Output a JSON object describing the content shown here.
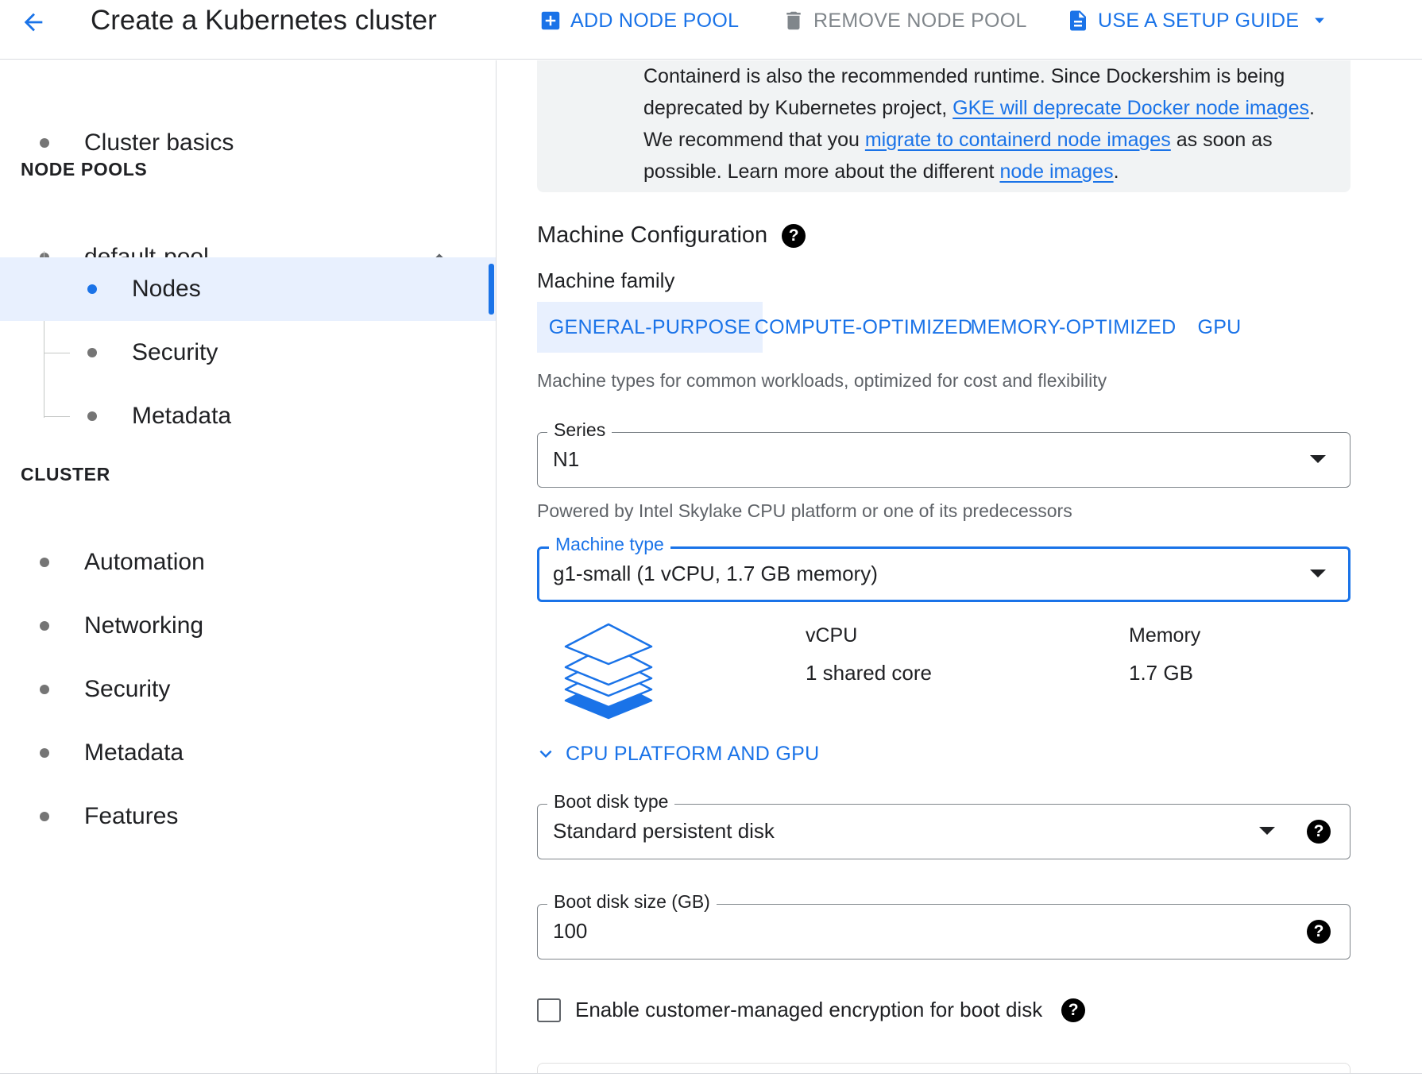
{
  "header": {
    "title": "Create a Kubernetes cluster",
    "add_node_pool": "ADD NODE POOL",
    "remove_node_pool": "REMOVE NODE POOL",
    "setup_guide": "USE A SETUP GUIDE"
  },
  "sidebar": {
    "cluster_basics": "Cluster basics",
    "node_pools_heading": "NODE POOLS",
    "default_pool": "default-pool",
    "pool_items": [
      "Nodes",
      "Security",
      "Metadata"
    ],
    "cluster_heading": "CLUSTER",
    "cluster_items": [
      "Automation",
      "Networking",
      "Security",
      "Metadata",
      "Features"
    ]
  },
  "info": {
    "text1": "Containerd is also the recommended runtime. Since Dockershim is being deprecated by Kubernetes project, ",
    "link1": "GKE will deprecate Docker node images",
    "text2": ". We recommend that you ",
    "link2": "migrate to containerd node images",
    "text3": " as soon as possible. Learn more about the different ",
    "link3": "node images",
    "text4": "."
  },
  "machine": {
    "section_title": "Machine Configuration",
    "family_label": "Machine family",
    "tabs": [
      "GENERAL-PURPOSE",
      "COMPUTE-OPTIMIZED",
      "MEMORY-OPTIMIZED",
      "GPU"
    ],
    "active_tab": "GENERAL-PURPOSE",
    "family_helper": "Machine types for common workloads, optimized for cost and flexibility",
    "series_label": "Series",
    "series_value": "N1",
    "series_helper": "Powered by Intel Skylake CPU platform or one of its predecessors",
    "type_label": "Machine type",
    "type_value": "g1-small (1 vCPU, 1.7 GB memory)",
    "vcpu_label": "vCPU",
    "vcpu_value": "1 shared core",
    "memory_label": "Memory",
    "memory_value": "1.7 GB",
    "cpu_platform": "CPU PLATFORM AND GPU"
  },
  "disk": {
    "type_label": "Boot disk type",
    "type_value": "Standard persistent disk",
    "size_label": "Boot disk size (GB)",
    "size_value": "100",
    "encryption_label": "Enable customer-managed encryption for boot disk",
    "encryption_checked": false
  },
  "colors": {
    "accent": "#1a73e8",
    "active_bg": "#e8f0fe",
    "info_bg": "#f1f3f4"
  }
}
